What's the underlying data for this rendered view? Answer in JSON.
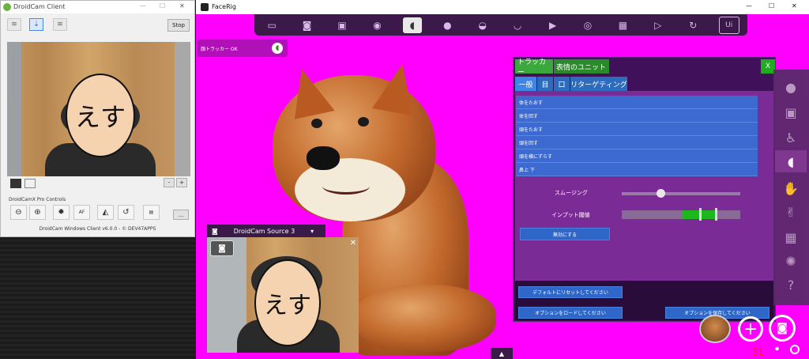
{
  "droidcam": {
    "title": "DroidCam Client",
    "win_min": "—",
    "win_max": "☐",
    "win_close": "✕",
    "stop_label": "Stop",
    "zoom_minus": "-",
    "zoom_plus": "+",
    "pro_controls_label": "DroidCamX Pro Controls",
    "af_label": "AF",
    "more_label": "...",
    "footer": "DroidCam Windows Client v6.0.0 - © DEV47APPS"
  },
  "facerig": {
    "title": "FaceRig",
    "win_min": "—",
    "win_max": "☐",
    "win_close": "✕",
    "tracker_status": "顔トラッカー OK",
    "ui_button": "Ui",
    "source_label": "DroidCam Source 3",
    "source_dropdown": "▾",
    "source_close": "✕",
    "mask_glyph": "えす",
    "bottom_indicator": "31",
    "panel": {
      "tabs": [
        "トラッカー",
        "表情のユニット"
      ],
      "close": "X",
      "subtabs": [
        "一般",
        "目",
        "口",
        "リターゲティング"
      ],
      "menu_items": [
        "体をたおす",
        "体を回す",
        "頭をたおす",
        "頭を回す",
        "頭を横にずらす",
        "鼻上 下"
      ],
      "smoothing_label": "スムージング",
      "input_label": "インプット閾値",
      "disable_button": "無効にする",
      "reset_button": "デフォルトにリセットしてください",
      "load_button": "オプションをロードしてください",
      "save_button": "オプションを保存してください"
    }
  },
  "colors": {
    "background_magenta": "#ff00ff",
    "panel_purple": "#40105a",
    "button_blue": "#2f67c9"
  },
  "icons": [
    "wifi-icon",
    "usb-icon",
    "wifi-s-icon",
    "zoom-out-icon",
    "zoom-in-icon",
    "light-icon",
    "mirror-icon",
    "rotate-icon",
    "jpg-icon",
    "camera-icon",
    "face-tracking-icon",
    "person-icon",
    "lips-icon",
    "eye-icon",
    "refresh-icon",
    "add-icon",
    "webcam-icon",
    "mic-icon"
  ]
}
